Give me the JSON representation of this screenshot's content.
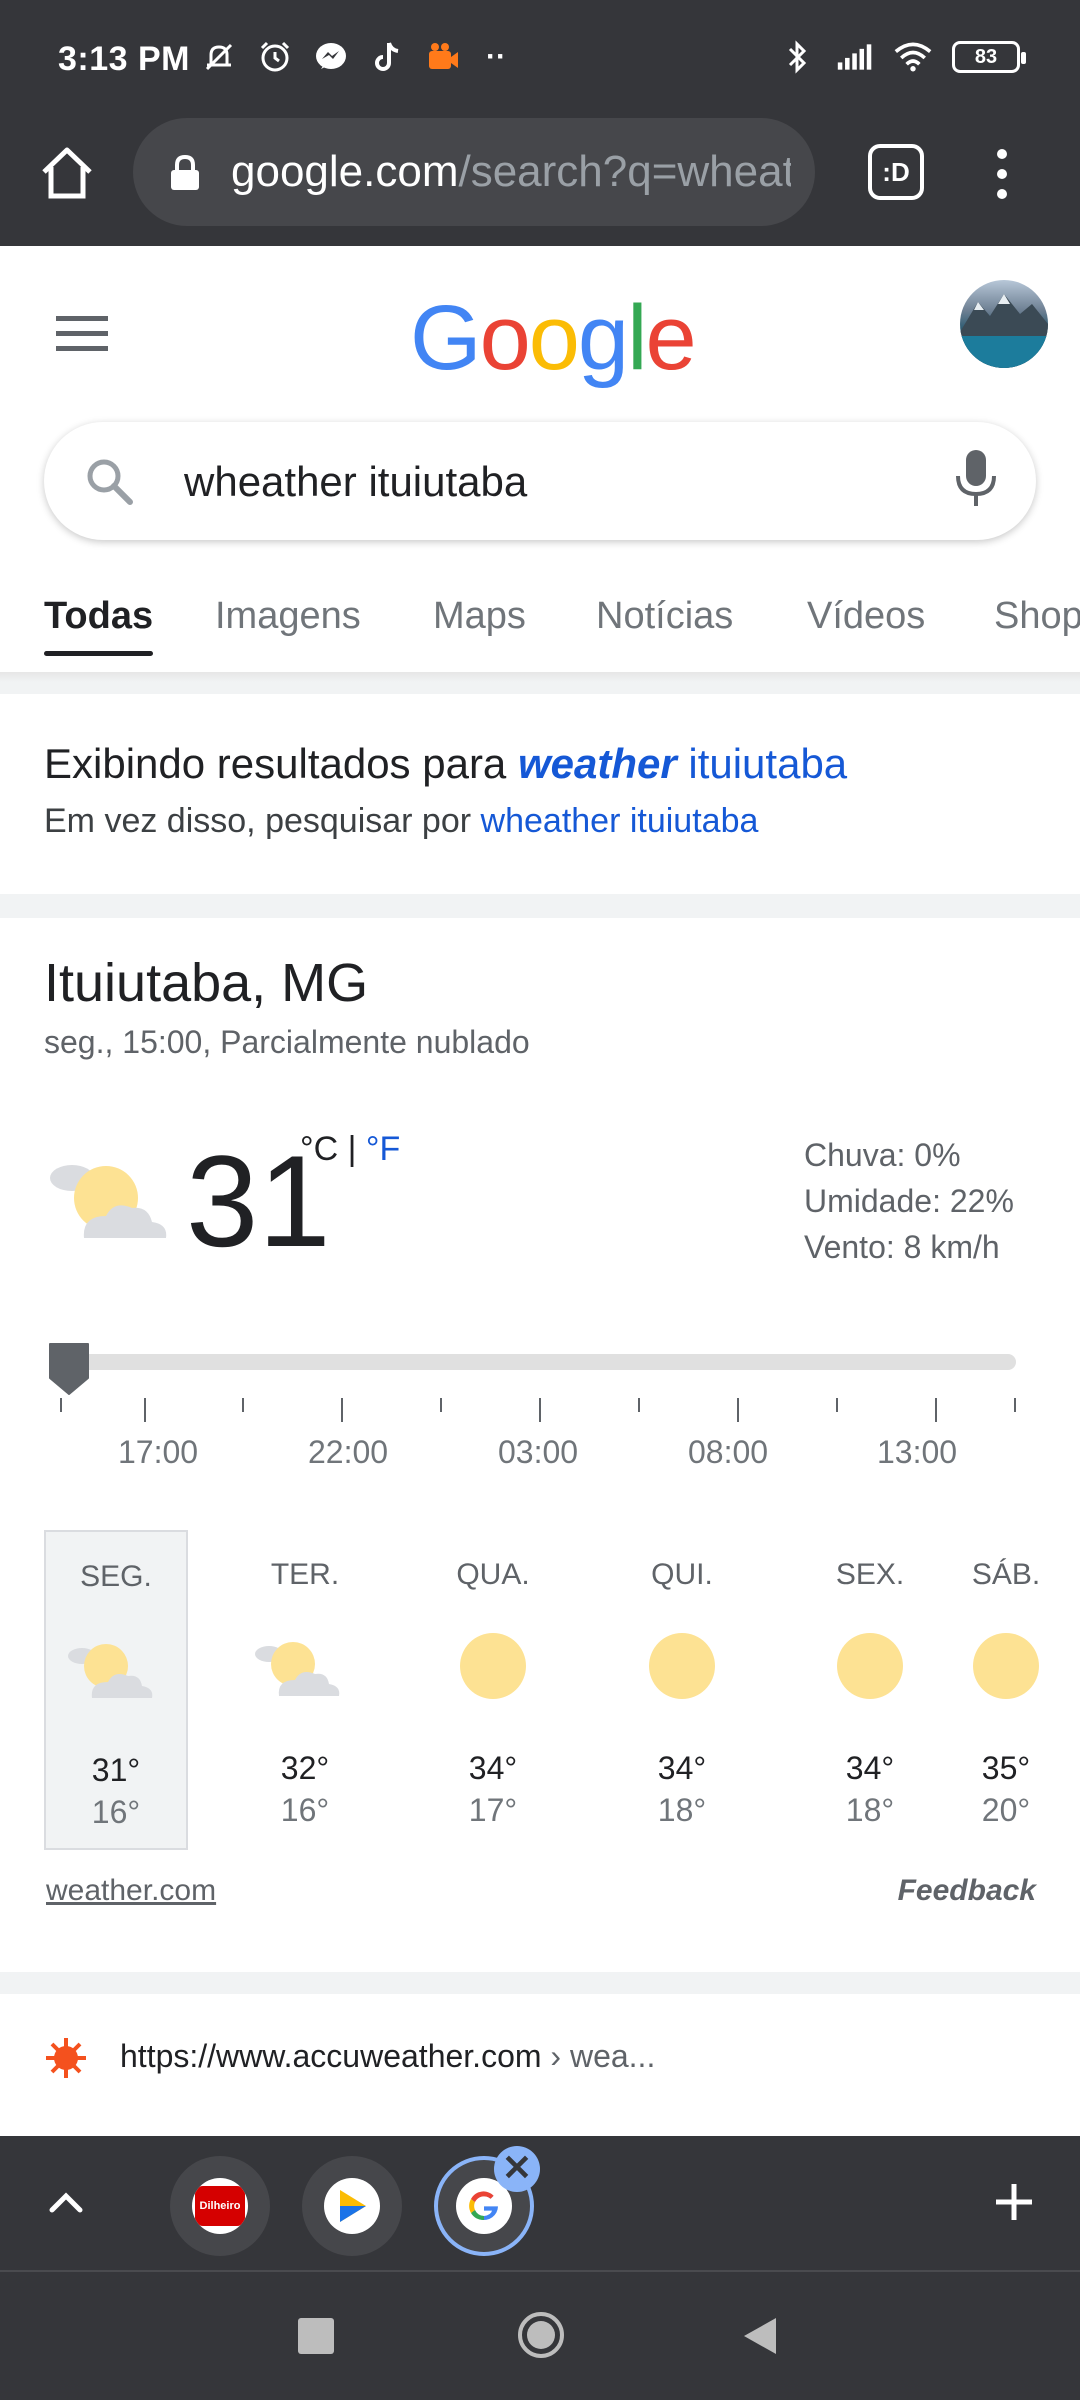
{
  "status_bar": {
    "time": "3:13 PM",
    "battery": "83",
    "icons_left": [
      "mute-icon",
      "alarm-icon",
      "messenger-icon",
      "tiktok-icon",
      "video-app-icon",
      "more-dots-icon"
    ],
    "icons_right": [
      "bluetooth-icon",
      "signal-icon",
      "wifi-icon",
      "battery-icon"
    ]
  },
  "browser": {
    "url_host": "google.com",
    "url_path": "/search?q=wheat",
    "tab_count_label": ":D"
  },
  "google": {
    "logo": [
      "G",
      "o",
      "o",
      "g",
      "l",
      "e"
    ],
    "logo_colors": [
      "#4285F4",
      "#EA4335",
      "#FBBC05",
      "#4285F4",
      "#34A853",
      "#EA4335"
    ],
    "query": "wheather ituiutaba",
    "tabs": [
      "Todas",
      "Imagens",
      "Maps",
      "Notícias",
      "Vídeos",
      "Shop"
    ]
  },
  "correction": {
    "prefix": "Exibindo resultados para ",
    "corrected_bold": "weather",
    "corrected_rest": " ituiutaba",
    "alt_prefix": "Em vez disso, pesquisar por ",
    "alt_query": "wheather ituiutaba"
  },
  "weather": {
    "location": "Ituiutaba, MG",
    "subtitle": "seg., 15:00, Parcialmente nublado",
    "temp": "31",
    "unit_c": "°C",
    "unit_sep": " | ",
    "unit_f": "°F",
    "rain": "Chuva: 0%",
    "humidity": "Umidade: 22%",
    "wind": "Vento: 8 km/h",
    "time_labels": [
      "17:00",
      "22:00",
      "03:00",
      "08:00",
      "13:00"
    ],
    "days": [
      {
        "name": "SEG.",
        "hi": "31°",
        "lo": "16°",
        "icon": "partly-cloudy"
      },
      {
        "name": "TER.",
        "hi": "32°",
        "lo": "16°",
        "icon": "partly-cloudy"
      },
      {
        "name": "QUA.",
        "hi": "34°",
        "lo": "17°",
        "icon": "sunny"
      },
      {
        "name": "QUI.",
        "hi": "34°",
        "lo": "18°",
        "icon": "sunny"
      },
      {
        "name": "SEX.",
        "hi": "34°",
        "lo": "18°",
        "icon": "sunny"
      },
      {
        "name": "SÁB.",
        "hi": "35°",
        "lo": "20°",
        "icon": "sunny"
      }
    ],
    "source": "weather.com",
    "feedback": "Feedback"
  },
  "result": {
    "url": "https://www.accuweather.com",
    "crumb": " › wea..."
  },
  "tab_strip": {
    "tab1_label": "Dilheiro",
    "close_symbol": "✕"
  }
}
